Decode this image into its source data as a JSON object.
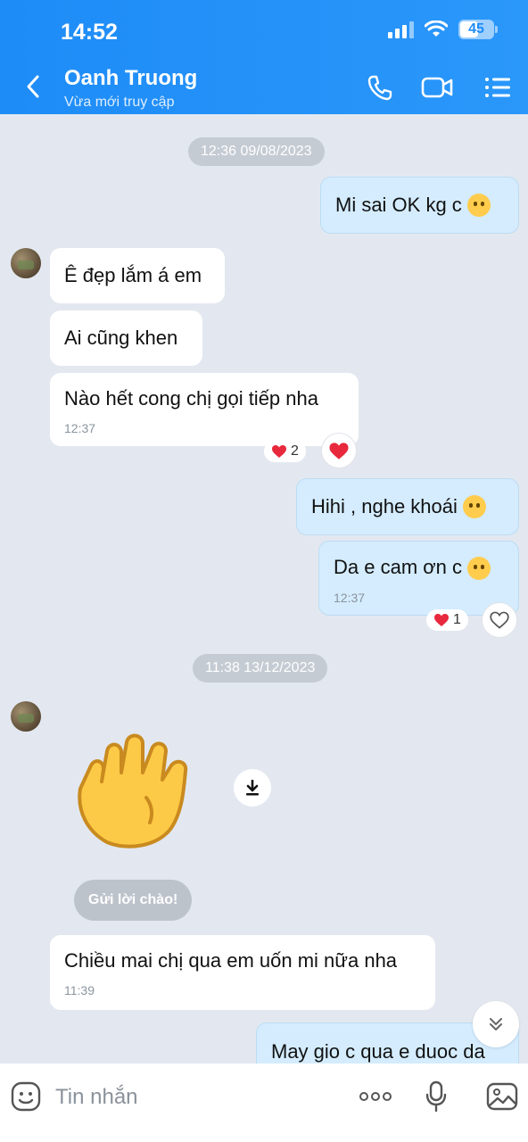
{
  "status_bar": {
    "time": "14:52",
    "battery": "45"
  },
  "header": {
    "contact_name": "Oanh Truong",
    "contact_status": "Vừa mới truy cập"
  },
  "messages": {
    "date1": "12:36 09/08/2023",
    "m1": "Mi sai OK kg c",
    "m2": "Ê đẹp lắm á em",
    "m3": "Ai cũng khen",
    "m4": "Nào hết cong chị gọi tiếp nha",
    "m4_time": "12:37",
    "m4_reaction_count": "2",
    "m5": "Hihi , nghe khoái",
    "m6": "Da e cam ơn c",
    "m6_time": "12:37",
    "m6_reaction_count": "1",
    "date2": "11:38 13/12/2023",
    "greet_button": "Gửi lời chào!",
    "m7": "Chiều mai chị qua em uốn mi nữa nha",
    "m7_time": "11:39",
    "m8": "May gio c qua e duoc da"
  },
  "input": {
    "placeholder": "Tin nhắn"
  },
  "colors": {
    "header": "#1e8cf7",
    "outgoing_bubble": "#d4ecfe",
    "incoming_bubble": "#ffffff",
    "background": "#e3e8f0",
    "heart": "#e8283c"
  }
}
